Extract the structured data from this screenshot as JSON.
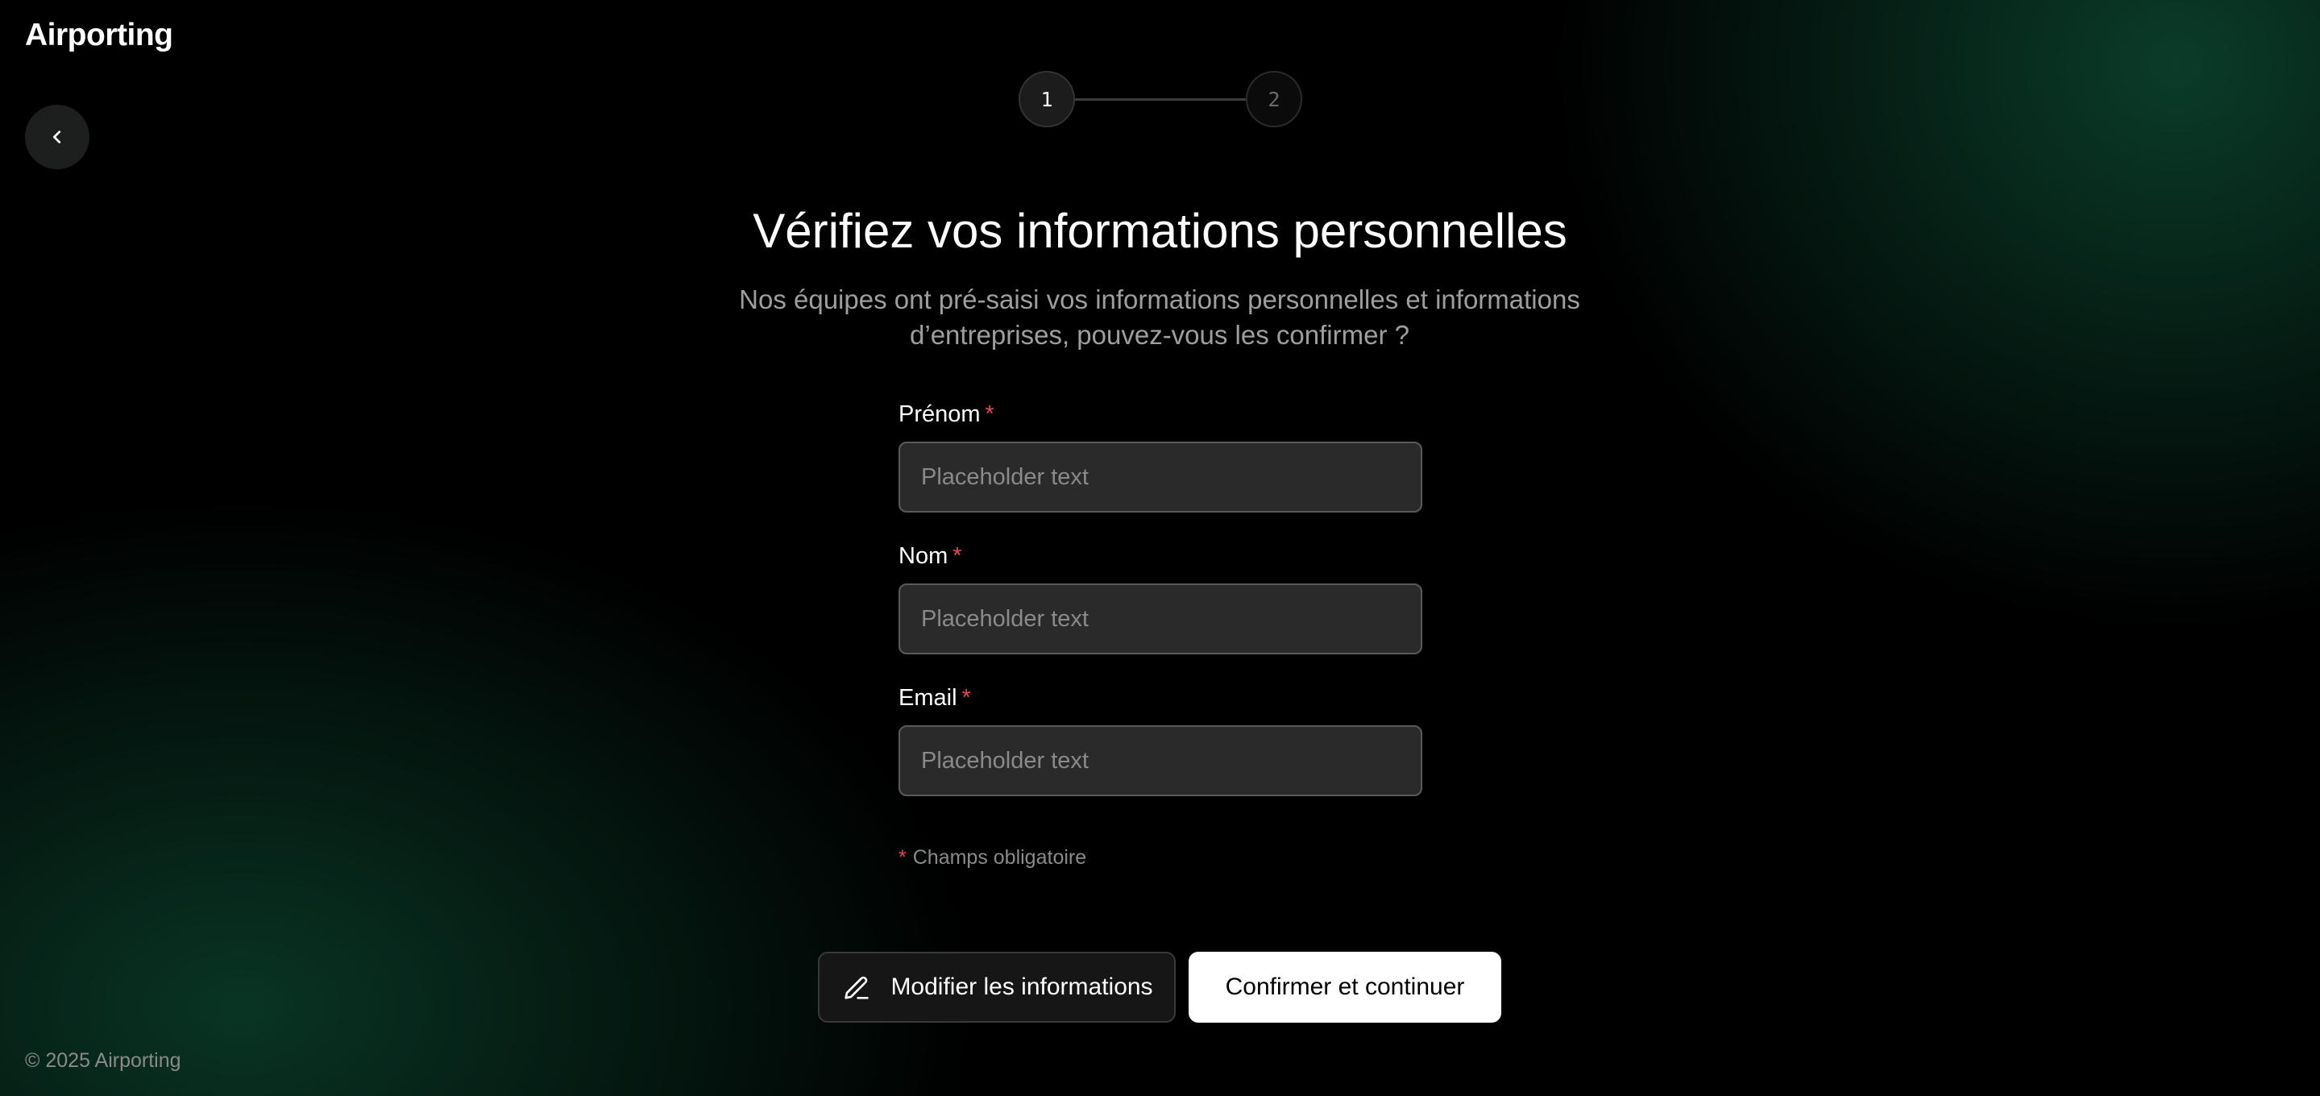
{
  "header": {
    "logo_text": "Airporting"
  },
  "navigation": {
    "back_icon": "chevron-left-icon"
  },
  "stepper": {
    "current_step": 1,
    "steps": [
      {
        "label": "1",
        "state": "active"
      },
      {
        "label": "2",
        "state": "inactive"
      }
    ]
  },
  "main": {
    "title": "Vérifiez vos informations personnelles",
    "subtitle_line1": "Nos équipes ont pré-saisi vos informations personnelles et informations",
    "subtitle_line2": "d’entreprises, pouvez-vous les confirmer ?"
  },
  "form": {
    "fields": [
      {
        "label": "Prénom",
        "required_mark": "*",
        "placeholder": "Placeholder text",
        "value": ""
      },
      {
        "label": "Nom",
        "required_mark": "*",
        "placeholder": "Placeholder text",
        "value": ""
      },
      {
        "label": "Email",
        "required_mark": "*",
        "placeholder": "Placeholder text",
        "value": ""
      }
    ],
    "required_note_mark": "*",
    "required_note_text": "Champs obligatoire"
  },
  "actions": {
    "edit_label": "Modifier les informations",
    "edit_icon": "pencil-icon",
    "confirm_label": "Confirmer et continuer"
  },
  "footer": {
    "copyright": "© 2025 Airporting"
  },
  "colors": {
    "background": "#000000",
    "accent_green": "#0e5037",
    "required_red": "#e5484d",
    "input_bg": "#2a2a2a",
    "primary_button_bg": "#ffffff"
  }
}
